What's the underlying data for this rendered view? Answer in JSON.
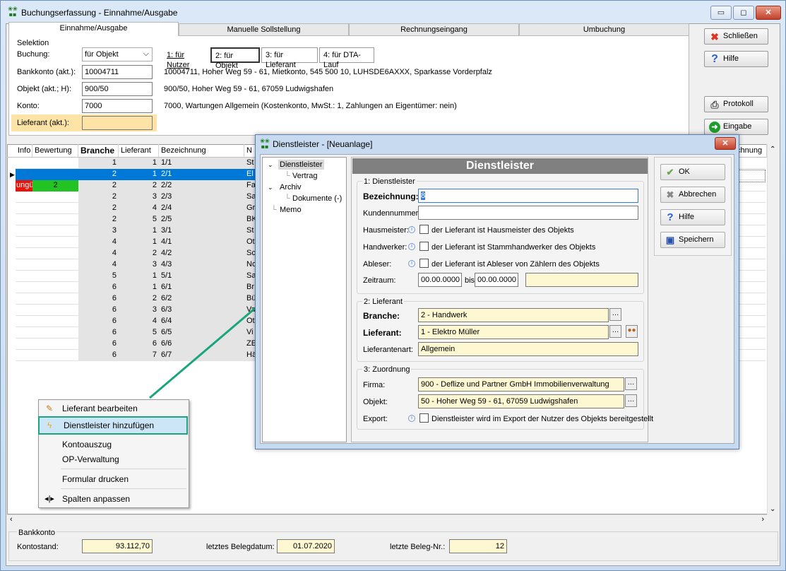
{
  "window": {
    "title": "Buchungserfassung - Einnahme/Ausgabe",
    "minimize": "▭",
    "maximize": "◻",
    "close": "✕"
  },
  "tabs": [
    "Einnahme/Ausgabe",
    "Manuelle Sollstellung",
    "Rechnungseingang",
    "Umbuchung"
  ],
  "selektion": {
    "group_label": "Selektion",
    "buchung_label": "Buchung:",
    "buchung_value": "für Objekt",
    "bankkonto_label": "Bankkonto (akt.):",
    "bankkonto_value": "10004711",
    "bankkonto_desc": "10004711,  Hoher Weg 59 - 61,  Mietkonto,  545 500 10,  LUHSDE6AXXX,  Sparkasse Vorderpfalz",
    "objekt_label": "Objekt (akt.; H):",
    "objekt_value": "900/50",
    "objekt_desc": "900/50,  Hoher Weg 59 - 61, 67059 Ludwigshafen",
    "konto_label": "Konto:",
    "konto_value": "7000",
    "konto_desc": "7000,  Wartungen Allgemein  (Kostenkonto,  MwSt.: 1,  Zahlungen an Eigentümer: nein)",
    "lieferant_label": "Lieferant (akt.):",
    "lieferant_value": ""
  },
  "mode_buttons": [
    "1: für Nutzer",
    "2: für Objekt",
    "3: für Lieferant",
    "4: für DTA-Lauf"
  ],
  "right_buttons": {
    "schliessen": "Schließen",
    "hilfe": "Hilfe",
    "protokoll": "Protokoll",
    "eingabe": "Eingabe"
  },
  "grid": {
    "headers": [
      "Info",
      "Bewertung",
      "Branche",
      "Lieferant",
      "Bezeichnung",
      "N",
      "chnung"
    ],
    "rows": [
      {
        "info": "",
        "bew": "",
        "branche": "1",
        "lief": "1",
        "bez": "1/1",
        "n": "St"
      },
      {
        "info": "",
        "bew": "",
        "branche": "2",
        "lief": "1",
        "bez": "2/1",
        "n": "El"
      },
      {
        "info": "ungü",
        "bew": "2",
        "branche": "2",
        "lief": "2",
        "bez": "2/2",
        "n": "Fa"
      },
      {
        "info": "",
        "bew": "",
        "branche": "2",
        "lief": "3",
        "bez": "2/3",
        "n": "Sa"
      },
      {
        "info": "",
        "bew": "",
        "branche": "2",
        "lief": "4",
        "bez": "2/4",
        "n": "Gr"
      },
      {
        "info": "",
        "bew": "",
        "branche": "2",
        "lief": "5",
        "bez": "2/5",
        "n": "BK"
      },
      {
        "info": "",
        "bew": "",
        "branche": "3",
        "lief": "1",
        "bez": "3/1",
        "n": "St"
      },
      {
        "info": "",
        "bew": "",
        "branche": "4",
        "lief": "1",
        "bez": "4/1",
        "n": "Ot"
      },
      {
        "info": "",
        "bew": "",
        "branche": "4",
        "lief": "2",
        "bez": "4/2",
        "n": "Sc"
      },
      {
        "info": "",
        "bew": "",
        "branche": "4",
        "lief": "3",
        "bez": "4/3",
        "n": "No"
      },
      {
        "info": "",
        "bew": "",
        "branche": "5",
        "lief": "1",
        "bez": "5/1",
        "n": "Sa"
      },
      {
        "info": "",
        "bew": "",
        "branche": "6",
        "lief": "1",
        "bez": "6/1",
        "n": "Br"
      },
      {
        "info": "",
        "bew": "",
        "branche": "6",
        "lief": "2",
        "bez": "6/2",
        "n": "Bü"
      },
      {
        "info": "",
        "bew": "",
        "branche": "6",
        "lief": "3",
        "bez": "6/3",
        "n": "Va"
      },
      {
        "info": "",
        "bew": "",
        "branche": "6",
        "lief": "4",
        "bez": "6/4",
        "n": "Ot"
      },
      {
        "info": "",
        "bew": "",
        "branche": "6",
        "lief": "5",
        "bez": "6/5",
        "n": "Vi"
      },
      {
        "info": "",
        "bew": "",
        "branche": "6",
        "lief": "6",
        "bez": "6/6",
        "n": "ZE"
      },
      {
        "info": "",
        "bew": "",
        "branche": "6",
        "lief": "7",
        "bez": "6/7",
        "n": "Hä"
      }
    ]
  },
  "context_menu": {
    "items": [
      "Lieferant bearbeiten",
      "Dienstleister hinzufügen",
      "Kontoauszug",
      "OP-Verwaltung",
      "Formular drucken",
      "Spalten anpassen"
    ]
  },
  "dialog": {
    "title": "Dienstleister - [Neuanlage]",
    "close": "✕",
    "tree": [
      "Dienstleister",
      "Vertrag",
      "Archiv",
      "Dokumente (-)",
      "Memo"
    ],
    "heading": "Dienstleister",
    "sec1": "1: Dienstleister",
    "bezeichnung_label": "Bezeichnung:",
    "bezeichnung_value": "8",
    "kundennummer_label": "Kundennummer:",
    "hausmeister_label": "Hausmeister:",
    "hausmeister_text": "der Lieferant ist Hausmeister des Objekts",
    "handwerker_label": "Handwerker:",
    "handwerker_text": "der Lieferant ist Stammhandwerker des Objekts",
    "ableser_label": "Ableser:",
    "ableser_text": "der Lieferant ist Ableser von Zählern des Objekts",
    "zeitraum_label": "Zeitraum:",
    "zeitraum_von": "00.00.0000",
    "zeitraum_bis_label": "bis",
    "zeitraum_bis": "00.00.0000",
    "sec2": "2: Lieferant",
    "branche_label": "Branche:",
    "branche_value": "2 - Handwerk",
    "lieferant_label": "Lieferant:",
    "lieferant_value": "1 - Elektro Müller",
    "lieferantenart_label": "Lieferantenart:",
    "lieferantenart_value": "Allgemein",
    "sec3": "3: Zuordnung",
    "firma_label": "Firma:",
    "firma_value": "900 - Deflize und Partner GmbH Immobilienverwaltung",
    "objekt_label": "Objekt:",
    "objekt_value": "50 - Hoher Weg 59 - 61, 67059 Ludwigshafen",
    "export_label": "Export:",
    "export_text": "Dienstleister wird im Export der Nutzer des Objekts bereitgestellt",
    "btn_ok": "OK",
    "btn_abbrechen": "Abbrechen",
    "btn_hilfe": "Hilfe",
    "btn_speichern": "Speichern"
  },
  "footer": {
    "group_label": "Bankkonto",
    "kontostand_label": "Kontostand:",
    "kontostand_value": "93.112,70",
    "belegdatum_label": "letztes Belegdatum:",
    "belegdatum_value": "01.07.2020",
    "belegnr_label": "letzte Beleg-Nr.:",
    "belegnr_value": "12"
  },
  "colors": {
    "selected_row": "#0078d7",
    "invalid": "#e8140c",
    "rating": "#22c322",
    "highlight_border": "#1aa57c",
    "arrow": "#1aa57c"
  }
}
